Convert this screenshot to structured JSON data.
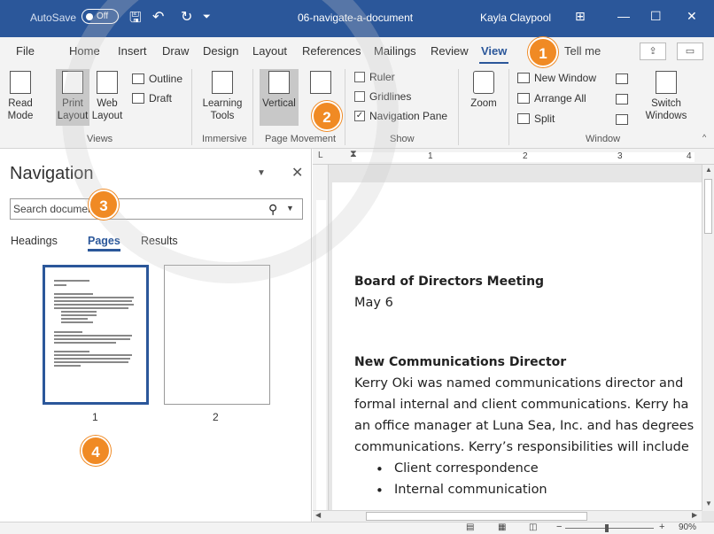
{
  "titlebar": {
    "autosave_label": "AutoSave",
    "autosave_state": "Off",
    "doc_title": "06-navigate-a-document",
    "user": "Kayla Claypool"
  },
  "tabs": [
    "File",
    "Home",
    "Insert",
    "Draw",
    "Design",
    "Layout",
    "References",
    "Mailings",
    "Review",
    "View"
  ],
  "active_tab": "View",
  "tell_me": "Tell me",
  "ribbon": {
    "views": {
      "label": "Views",
      "read_mode": "Read Mode",
      "print_layout": "Print Layout",
      "web_layout": "Web Layout",
      "outline": "Outline",
      "draft": "Draft"
    },
    "immersive": {
      "label": "Immersive",
      "learning_tools": "Learning Tools"
    },
    "page_movement": {
      "label": "Page Movement",
      "vertical": "Vertical"
    },
    "show": {
      "label": "Show",
      "ruler": "Ruler",
      "gridlines": "Gridlines",
      "navigation_pane": "Navigation Pane",
      "nav_checked": true
    },
    "zoom": {
      "label": "Zoom"
    },
    "window": {
      "label": "Window",
      "new_window": "New Window",
      "arrange_all": "Arrange All",
      "split": "Split",
      "switch_windows": "Switch Windows"
    }
  },
  "nav": {
    "title": "Navigation",
    "search_placeholder": "Search document",
    "tabs": [
      "Headings",
      "Pages",
      "Results"
    ],
    "active_tab": "Pages",
    "page_numbers": [
      "1",
      "2"
    ]
  },
  "ruler_numbers": [
    "1",
    "2",
    "3",
    "4"
  ],
  "document": {
    "heading1": "Board of Directors Meeting",
    "date": "May 6",
    "heading2": "New Communications Director",
    "lines": [
      "Kerry Oki was named communications director and",
      "formal internal and client communications. Kerry ha",
      "an office manager at Luna Sea, Inc. and has degrees",
      "communications. Kerry’s responsibilities will include"
    ],
    "bullets": [
      "Client correspondence",
      "Internal communication"
    ]
  },
  "status": {
    "zoom": "90%"
  },
  "callouts": [
    "1",
    "2",
    "3",
    "4"
  ],
  "colors": {
    "accent": "#2b579a",
    "callout": "#f08a24"
  }
}
